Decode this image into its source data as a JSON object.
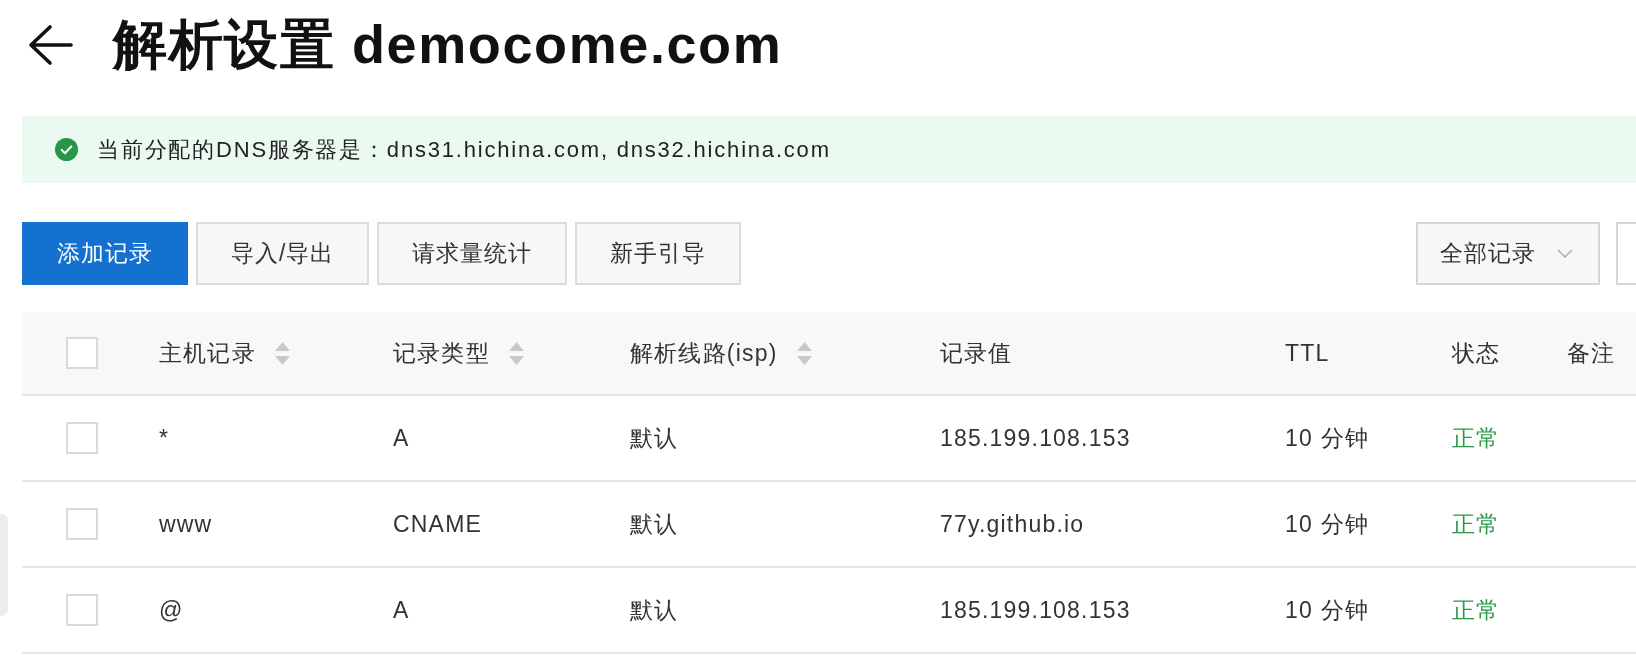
{
  "header": {
    "title": "解析设置 democome.com"
  },
  "alert": {
    "kind": "success",
    "text": "当前分配的DNS服务器是：dns31.hichina.com, dns32.hichina.com"
  },
  "toolbar": {
    "buttons": [
      {
        "label": "添加记录",
        "kind": "primary"
      },
      {
        "label": "导入/导出",
        "kind": "default"
      },
      {
        "label": "请求量统计",
        "kind": "default"
      },
      {
        "label": "新手引导",
        "kind": "default"
      }
    ],
    "filter": {
      "value": "全部记录"
    }
  },
  "table": {
    "select_all": {
      "checked": false
    },
    "columns": [
      {
        "label": "主机记录",
        "sortable": true
      },
      {
        "label": "记录类型",
        "sortable": true
      },
      {
        "label": "解析线路(isp)",
        "sortable": true
      },
      {
        "label": "记录值",
        "sortable": false
      },
      {
        "label": "TTL",
        "sortable": false
      },
      {
        "label": "状态",
        "sortable": false
      },
      {
        "label": "备注",
        "sortable": false
      }
    ],
    "rows": [
      {
        "checked": false,
        "cells": [
          "*",
          "A",
          "默认",
          "185.199.108.153",
          "10 分钟"
        ],
        "status": {
          "text": "正常",
          "kind": "normal"
        }
      },
      {
        "checked": false,
        "cells": [
          "www",
          "CNAME",
          "默认",
          "77y.github.io",
          "10 分钟"
        ],
        "status": {
          "text": "正常",
          "kind": "normal"
        }
      },
      {
        "checked": false,
        "cells": [
          "@",
          "A",
          "默认",
          "185.199.108.153",
          "10 分钟"
        ],
        "status": {
          "text": "正常",
          "kind": "normal"
        }
      }
    ]
  }
}
